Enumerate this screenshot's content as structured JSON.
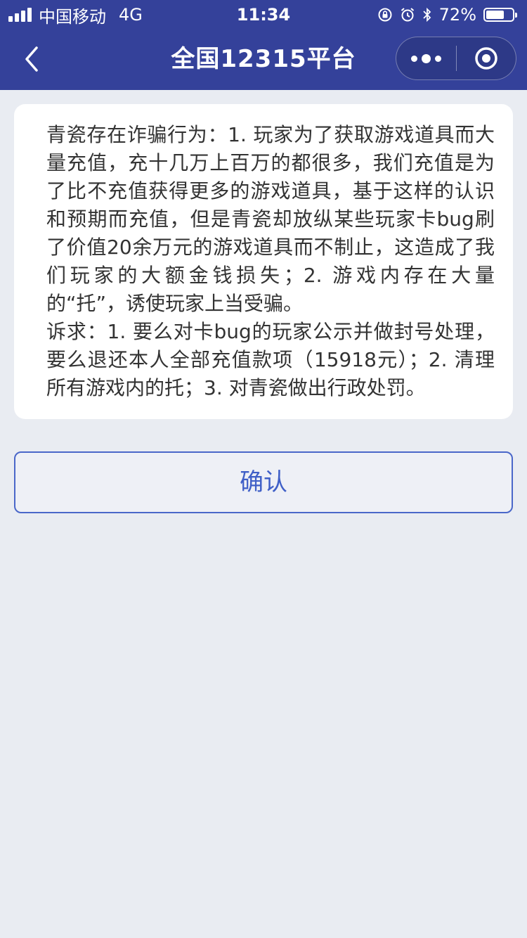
{
  "status_bar": {
    "carrier": "中国移动",
    "network": "4G",
    "time": "11:34",
    "battery_text": "72%",
    "battery_level": 0.72,
    "icons": [
      "signal-icon",
      "orientation-lock-icon",
      "alarm-icon",
      "bluetooth-icon",
      "battery-icon"
    ]
  },
  "navbar": {
    "title": "全国12315平台",
    "back_icon": "chevron-left-icon",
    "more_icon": "more-dots-icon",
    "close_icon": "target-close-icon"
  },
  "complaint": {
    "content": "青瓷存在诈骗行为：1. 玩家为了获取游戏道具而大量充值，充十几万上百万的都很多，我们充值是为了比不充值获得更多的游戏道具，基于这样的认识和预期而充值，但是青瓷却放纵某些玩家卡bug刷了价值20余万元的游戏道具而不制止，这造成了我们玩家的大额金钱损失；2. 游戏内存在大量的“托”，诱使玩家上当受骗。",
    "appeal": "诉求：1. 要么对卡bug的玩家公示并做封号处理，要么退还本人全部充值款项（15918元）；2. 清理所有游戏内的托；3. 对青瓷做出行政处罚。"
  },
  "actions": {
    "confirm_label": "确认"
  },
  "colors": {
    "header_bg": "#34419a",
    "page_bg": "#e9ecf2",
    "accent": "#3f5fc7",
    "text": "#333333"
  }
}
